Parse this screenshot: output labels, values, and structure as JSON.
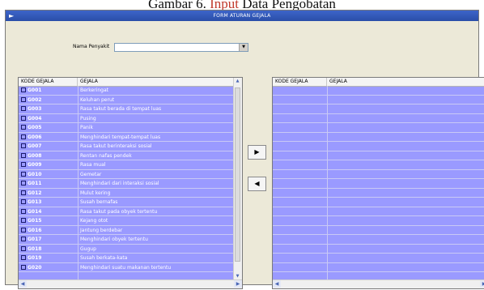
{
  "caption": {
    "before": "Gambar 6. ",
    "highlight": "Input",
    "after": " Data Pengobatan"
  },
  "window": {
    "title": "FORM ATURAN GEJALA"
  },
  "filter": {
    "label": "Nama Penyakit",
    "value": ""
  },
  "left_table": {
    "columns": [
      "KODE GEJALA",
      "GEJALA"
    ],
    "rows": [
      {
        "code": "G001",
        "name": "Berkeringat"
      },
      {
        "code": "G002",
        "name": "Keluhan perut"
      },
      {
        "code": "G003",
        "name": "Rasa takut berada di tempat luas"
      },
      {
        "code": "G004",
        "name": "Pusing"
      },
      {
        "code": "G005",
        "name": "Panik"
      },
      {
        "code": "G006",
        "name": "Menghindari tempat-tempat luas"
      },
      {
        "code": "G007",
        "name": "Rasa takut berinteraksi sosial"
      },
      {
        "code": "G008",
        "name": "Rentan nafas pendek"
      },
      {
        "code": "G009",
        "name": "Rasa mual"
      },
      {
        "code": "G010",
        "name": "Gemetar"
      },
      {
        "code": "G011",
        "name": "Menghindari dari interaksi sosial"
      },
      {
        "code": "G012",
        "name": "Mulut kering"
      },
      {
        "code": "G013",
        "name": "Susah bernafas"
      },
      {
        "code": "G014",
        "name": "Rasa takut pada obyek tertentu"
      },
      {
        "code": "G015",
        "name": "Kejang otot"
      },
      {
        "code": "G016",
        "name": "Jantung berdebar"
      },
      {
        "code": "G017",
        "name": "Menghindari obyek tertentu"
      },
      {
        "code": "G018",
        "name": "Gugup"
      },
      {
        "code": "G019",
        "name": "Susah berkata-kata"
      },
      {
        "code": "G020",
        "name": "Menghindari suatu makanan tertentu"
      }
    ]
  },
  "right_table": {
    "columns": [
      "KODE GEJALA",
      "GEJALA"
    ]
  },
  "buttons": {
    "add_icon": "triangle-right-icon",
    "add_glyph": "▶",
    "remove_icon": "triangle-left-icon",
    "remove_glyph": "◀"
  },
  "colors": {
    "list_bg": "#9a9aff",
    "titlebar": "#2a4ea8"
  }
}
